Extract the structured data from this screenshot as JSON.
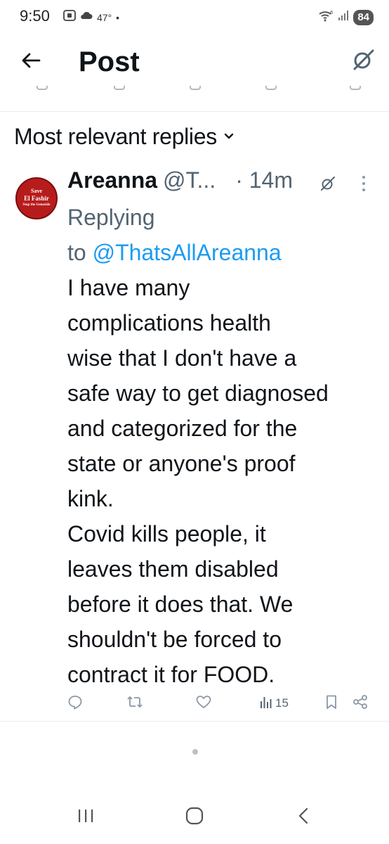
{
  "status_bar": {
    "time": "9:50",
    "temperature": "47°",
    "battery": "84",
    "icons": [
      "screenshot-icon",
      "cloud-icon",
      "wifi-icon",
      "signal-icon"
    ]
  },
  "header": {
    "title": "Post",
    "back_icon": "arrow-left-icon",
    "grok_icon": "grok-icon"
  },
  "replies_section": {
    "sort_label": "Most relevant replies",
    "sort_icon": "chevron-down-icon"
  },
  "reply": {
    "author_name": "Areanna",
    "author_handle": "@T...",
    "time": "· 14m",
    "avatar_text": [
      "Save",
      "El Fashir",
      "Stop the Genocide"
    ],
    "avatar_color": "#b71c1c",
    "replying_label": "Replying",
    "replying_to_prefix": "to ",
    "replying_to_handle": "@ThatsAllAreanna",
    "text": "I have many\ncomplications health\nwise that I don't have a\nsafe way to get diagnosed\nand categorized for the\nstate or anyone's proof\nkink.\nCovid kills people, it\nleaves them disabled\nbefore it does that. We\nshouldn't be forced to\ncontract it for FOOD.",
    "views": "15"
  },
  "colors": {
    "text": "#0f1419",
    "secondary": "#536471",
    "link": "#1d9bf0",
    "icon": "#8b98a5"
  }
}
